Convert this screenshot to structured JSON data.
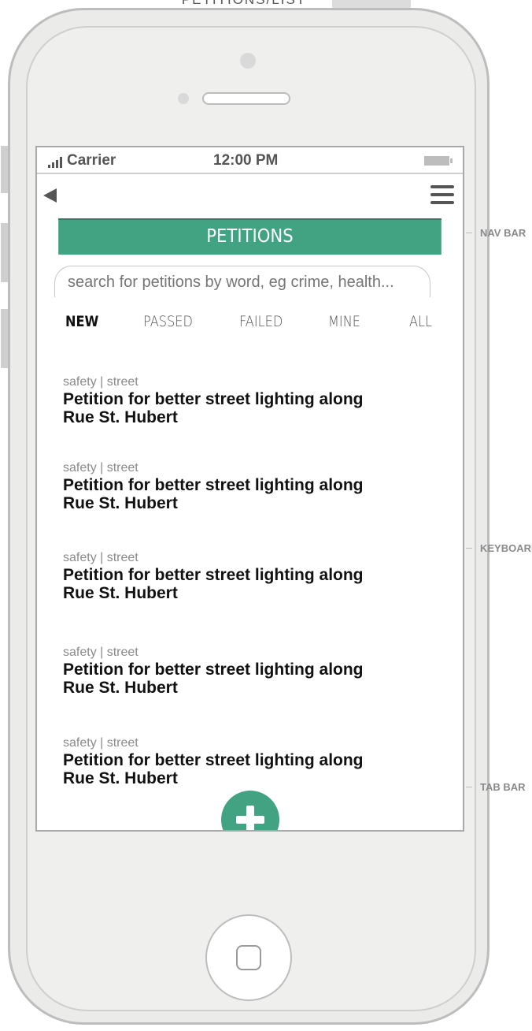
{
  "page_title": "PETITIONS/LIST",
  "status_bar": {
    "carrier": "Carrier",
    "time": "12:00 PM"
  },
  "nav": {
    "back_icon": "back-arrow-icon",
    "menu_icon": "hamburger-menu-icon",
    "title": "PETITIONS"
  },
  "search": {
    "placeholder": "search for petitions by word, eg crime, health..."
  },
  "tabs": [
    {
      "label": "NEW",
      "active": true
    },
    {
      "label": "PASSED",
      "active": false
    },
    {
      "label": "FAILED",
      "active": false
    },
    {
      "label": "MINE",
      "active": false
    },
    {
      "label": "ALL",
      "active": false
    }
  ],
  "petitions": [
    {
      "tags": "safety | street",
      "title_line1": "Petition for better street lighting along",
      "title_line2": "Rue St. Hubert"
    },
    {
      "tags": "safety | street",
      "title_line1": "Petition for better street lighting along",
      "title_line2": "Rue St. Hubert"
    },
    {
      "tags": "safety | street",
      "title_line1": "Petition for better street lighting along",
      "title_line2": "Rue St. Hubert"
    },
    {
      "tags": "safety | street",
      "title_line1": "Petition for better street lighting along",
      "title_line2": "Rue St. Hubert"
    },
    {
      "tags": "safety | street",
      "title_line1": "Petition for better street lighting along",
      "title_line2": "Rue St. Hubert"
    }
  ],
  "add_button": {
    "icon": "plus-icon"
  },
  "annotations": {
    "nav_bar": "NAV BAR",
    "keyboard": "KEYBOARD",
    "tab_bar": "TAB BAR"
  },
  "colors": {
    "accent": "#41a381",
    "phone_body": "#ebebea",
    "text_dark": "#111111",
    "text_muted": "#8a8a8a"
  }
}
